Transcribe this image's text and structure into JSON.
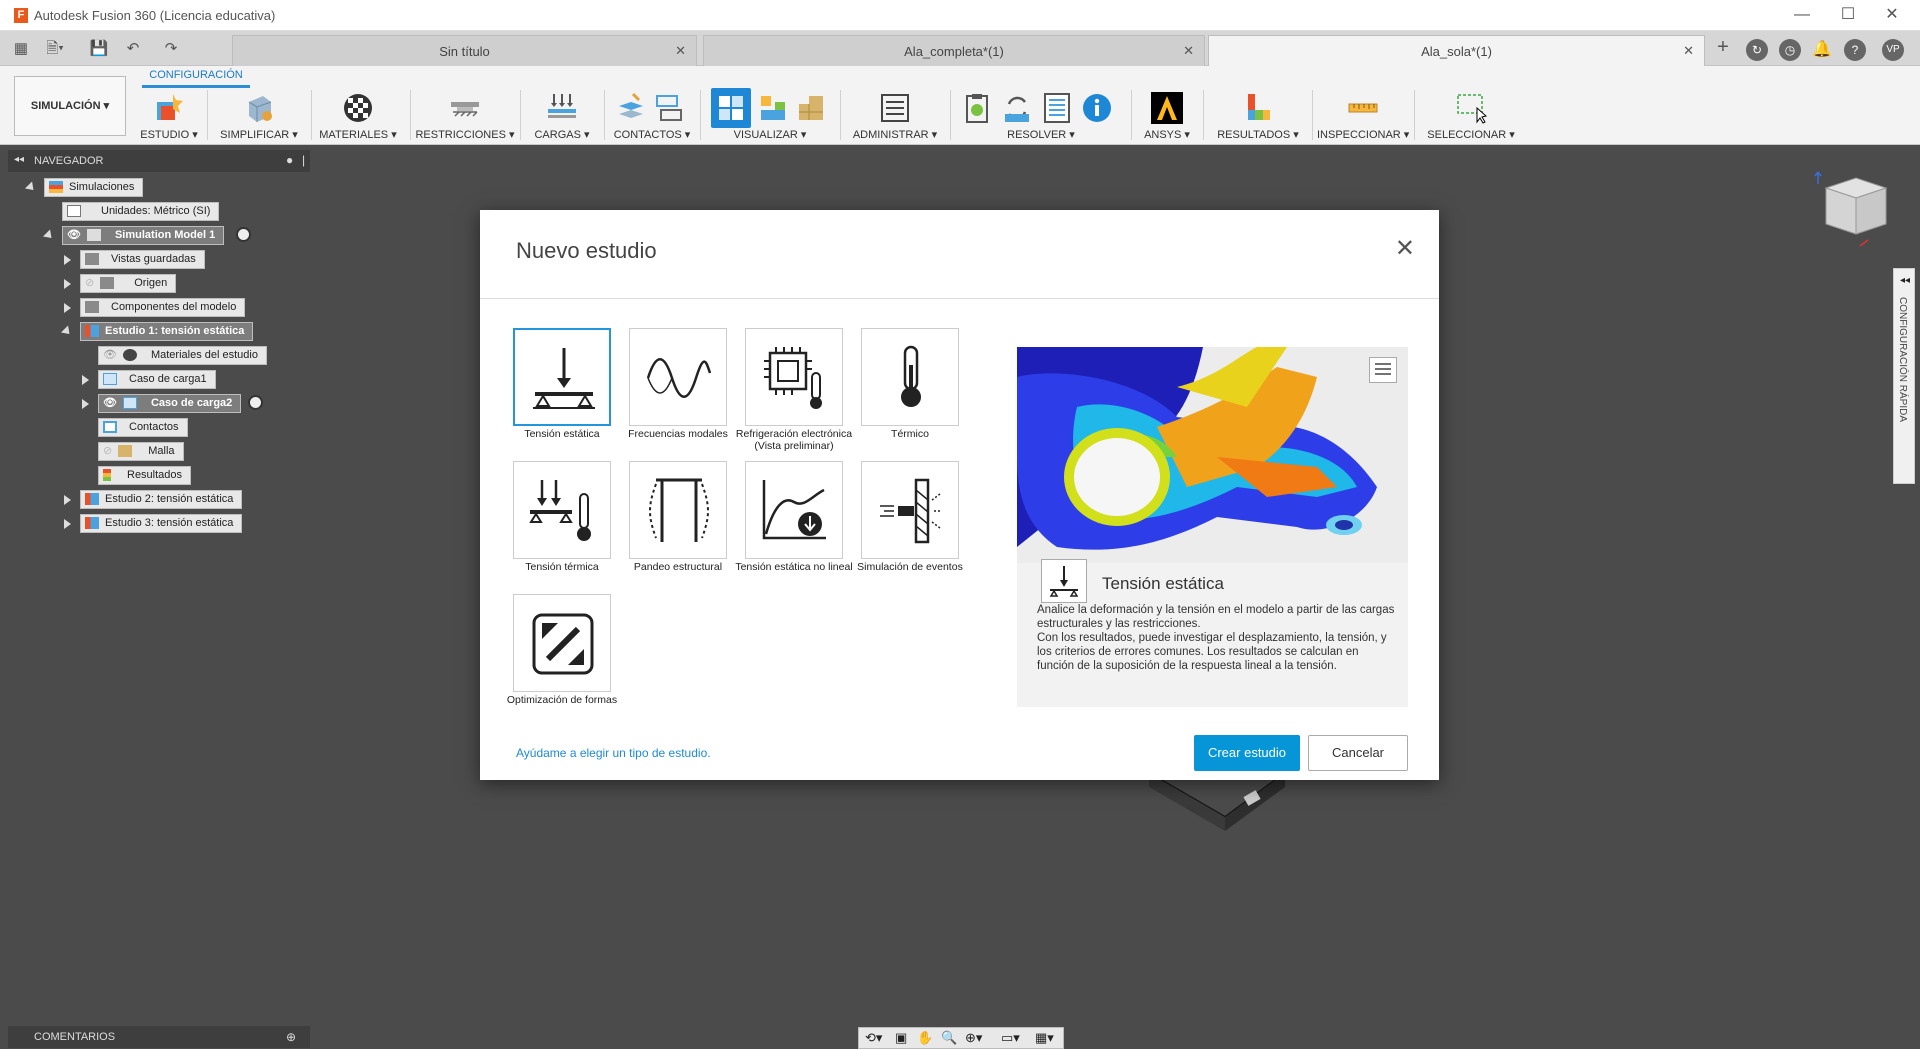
{
  "window": {
    "title": "Autodesk Fusion 360 (Licencia educativa)",
    "logo": "F",
    "controls": [
      "minimize-icon",
      "maximize-icon",
      "close-icon"
    ]
  },
  "tabs": [
    {
      "label": "Sin título",
      "active": false
    },
    {
      "label": "Ala_completa*(1)",
      "active": false
    },
    {
      "label": "Ala_sola*(1)",
      "active": true
    }
  ],
  "user_initials": "VP",
  "ribbon": {
    "workspace": "SIMULACIÓN ▾",
    "config_tab": "CONFIGURACIÓN",
    "groups": [
      {
        "label": "ESTUDIO ▾"
      },
      {
        "label": "SIMPLIFICAR ▾"
      },
      {
        "label": "MATERIALES ▾"
      },
      {
        "label": "RESTRICCIONES ▾"
      },
      {
        "label": "CARGAS ▾"
      },
      {
        "label": "CONTACTOS ▾"
      },
      {
        "label": "VISUALIZAR ▾"
      },
      {
        "label": "ADMINISTRAR ▾"
      },
      {
        "label": "RESOLVER ▾"
      },
      {
        "label": "ANSYS ▾"
      },
      {
        "label": "RESULTADOS ▾"
      },
      {
        "label": "INSPECCIONAR ▾"
      },
      {
        "label": "SELECCIONAR ▾"
      }
    ]
  },
  "navigator": {
    "header": "NAVEGADOR",
    "items": [
      {
        "label": "Simulaciones"
      },
      {
        "label": "Unidades: Métrico (SI)"
      },
      {
        "label": "Simulation Model 1"
      },
      {
        "label": "Vistas guardadas"
      },
      {
        "label": "Origen"
      },
      {
        "label": "Componentes del modelo"
      },
      {
        "label": "Estudio 1: tensión estática"
      },
      {
        "label": "Materiales del estudio"
      },
      {
        "label": "Caso de carga1"
      },
      {
        "label": "Caso de carga2"
      },
      {
        "label": "Contactos"
      },
      {
        "label": "Malla"
      },
      {
        "label": "Resultados"
      },
      {
        "label": "Estudio 2: tensión estática"
      },
      {
        "label": "Estudio 3: tensión estática"
      }
    ]
  },
  "comments_label": "COMENTARIOS",
  "quick_settings_label": "CONFIGURACIÓN RÁPIDA",
  "dialog": {
    "title": "Nuevo estudio",
    "study_types": [
      {
        "label": "Tensión estática",
        "icon": "static-stress-icon"
      },
      {
        "label": "Frecuencias modales",
        "icon": "modal-frequencies-icon"
      },
      {
        "label": "Refrigeración electrónica (Vista preliminar)",
        "icon": "electronics-cooling-icon"
      },
      {
        "label": "Térmico",
        "icon": "thermal-icon"
      },
      {
        "label": "Tensión térmica",
        "icon": "thermal-stress-icon"
      },
      {
        "label": "Pandeo estructural",
        "icon": "structural-buckling-icon"
      },
      {
        "label": "Tensión estática no lineal",
        "icon": "nonlinear-static-stress-icon"
      },
      {
        "label": "Simulación de eventos",
        "icon": "event-simulation-icon"
      },
      {
        "label": "Optimización de formas",
        "icon": "shape-optimization-icon"
      }
    ],
    "selected_index": 0,
    "preview": {
      "title": "Tensión estática",
      "description_1": "Analice la deformación y la tensión en el modelo a partir de las cargas estructurales y las restricciones.",
      "description_2": "Con los resultados, puede investigar el desplazamiento, la tensión, y los criterios de errores comunes. Los resultados se calculan en función de la suposición de la respuesta lineal a la tensión."
    },
    "help_link": "Ayúdame a elegir un tipo de estudio.",
    "create_button": "Crear estudio",
    "cancel_button": "Cancelar"
  },
  "colors": {
    "accent": "#0696d7",
    "link": "#1e8ad3",
    "canvas": "#4b4b4b",
    "ribbon": "#f3f3f3"
  }
}
